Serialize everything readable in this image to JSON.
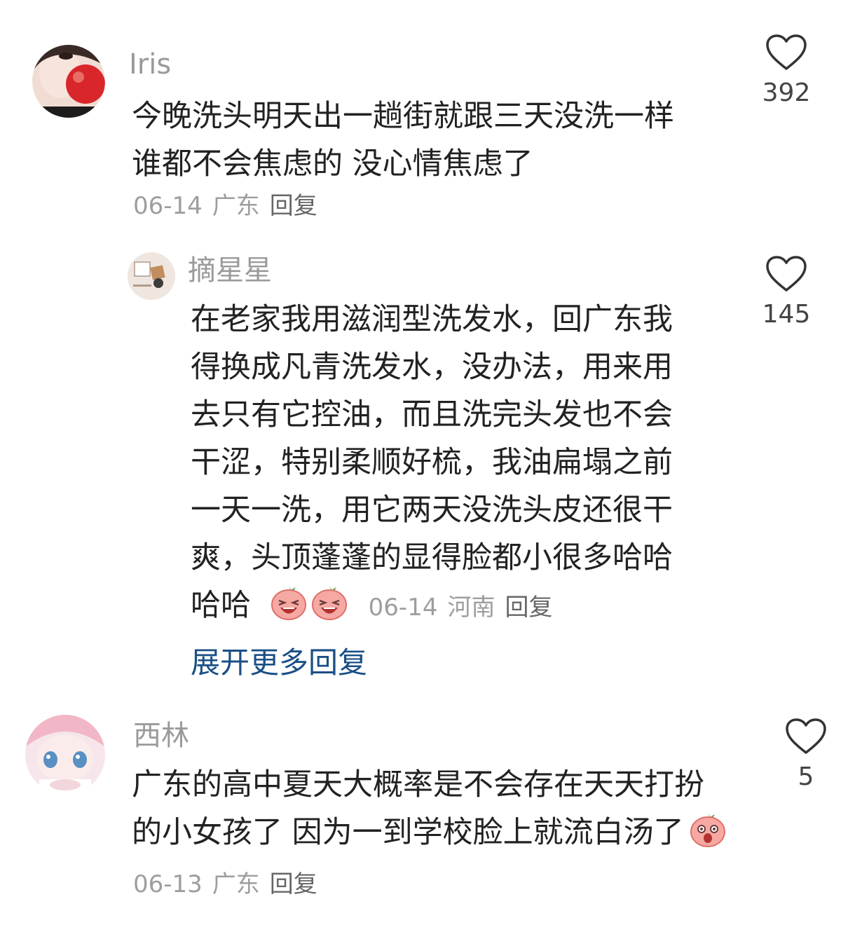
{
  "comments": [
    {
      "username": "Iris",
      "text_lines": [
        "今晚洗头明天出一趟街就跟三天没洗一样",
        "谁都不会焦虑的 没心情焦虑了"
      ],
      "date": "06-14",
      "location": "广东",
      "reply_label": "回复",
      "likes": "392",
      "reply": {
        "username": "摘星星",
        "text_lines": [
          "在老家我用滋润型洗发水，回广东我",
          "得换成凡青洗发水，没办法，用来用",
          "去只有它控油，而且洗完头发也不会",
          "干涩，特别柔顺好梳，我油扁塌之前",
          "一天一洗，用它两天没洗头皮还很干",
          "爽，头顶蓬蓬的显得脸都小很多哈哈",
          "哈哈"
        ],
        "emojis": [
          "laughing-emoji",
          "laughing-emoji"
        ],
        "date": "06-14",
        "location": "河南",
        "reply_label": "回复",
        "likes": "145"
      },
      "expand_label": "展开更多回复"
    },
    {
      "username": "西林",
      "text_lines": [
        "广东的高中夏天大概率是不会存在天天打扮",
        "的小女孩了 因为一到学校脸上就流白汤了"
      ],
      "emojis": [
        "shocked-emoji"
      ],
      "date": "06-13",
      "location": "广东",
      "reply_label": "回复",
      "likes": "5"
    }
  ],
  "colors": {
    "link": "#1a4f86",
    "meta": "#9e9e9e",
    "text": "#222222"
  }
}
